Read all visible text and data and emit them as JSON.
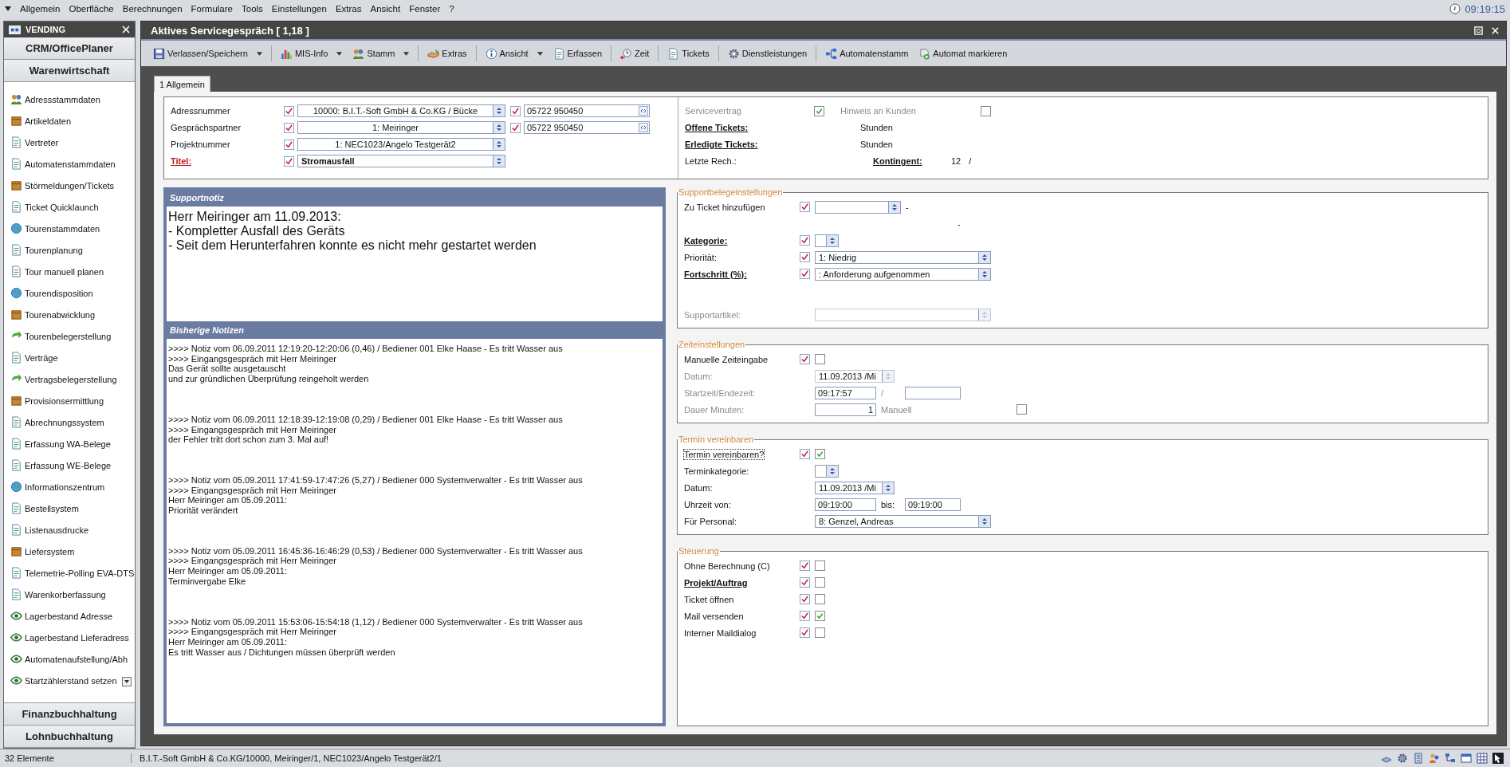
{
  "menu": [
    "Allgemein",
    "Oberfläche",
    "Berechnungen",
    "Formulare",
    "Tools",
    "Einstellungen",
    "Extras",
    "Ansicht",
    "Fenster",
    "?"
  ],
  "clock": "09:19:15",
  "sidebar": {
    "title": "VENDING",
    "top_sections": [
      "CRM/OfficePlaner",
      "Warenwirtschaft"
    ],
    "items": [
      "Adressstammdaten",
      "Artikeldaten",
      "Vertreter",
      "Automatenstammdaten",
      "Störmeldungen/Tickets",
      "Ticket Quicklaunch",
      "Tourenstammdaten",
      "Tourenplanung",
      "Tour manuell planen",
      "Tourendisposition",
      "Tourenabwicklung",
      "Tourenbelegerstellung",
      "Verträge",
      "Vertragsbelegerstellung",
      "Provisionsermittlung",
      "Abrechnungssystem",
      "Erfassung WA-Belege",
      "Erfassung WE-Belege",
      "Informationszentrum",
      "Bestellsystem",
      "Listenausdrucke",
      "Liefersystem",
      "Telemetrie-Polling EVA-DTS",
      "Warenkorberfassung",
      "Lagerbestand Adresse",
      "Lagerbestand Lieferadress",
      "Automatenaufstellung/Abh",
      "Startzählerstand setzen"
    ],
    "bottom_sections": [
      "Finanzbuchhaltung",
      "Lohnbuchhaltung"
    ]
  },
  "window": {
    "title": "Aktives Servicegespräch [ 1,18 ]"
  },
  "toolbar": [
    {
      "label": "Verlassen/Speichern",
      "dropdown": true
    },
    {
      "label": "MIS-Info",
      "dropdown": true
    },
    {
      "label": "Stamm",
      "dropdown": true
    },
    {
      "label": "Extras",
      "dropdown": false
    },
    {
      "label": "Ansicht",
      "dropdown": true
    },
    {
      "label": "Erfassen",
      "dropdown": false
    },
    {
      "label": "Zeit",
      "dropdown": false
    },
    {
      "label": "Tickets",
      "dropdown": false
    },
    {
      "label": "Dienstleistungen",
      "dropdown": false
    },
    {
      "label": "Automatenstamm",
      "dropdown": false
    },
    {
      "label": "Automat markieren",
      "dropdown": false
    }
  ],
  "tabs": [
    {
      "label": "1 Allgemein",
      "selected": true
    }
  ],
  "header_left": [
    {
      "label": "Adressnummer",
      "required": false,
      "value": "10000: B.I.T.-Soft GmbH & Co.KG / Bücke",
      "bold": false,
      "phone": "05722 950450"
    },
    {
      "label": "Gesprächspartner",
      "required": false,
      "value": "1: Meiringer",
      "bold": false,
      "phone": "05722 950450"
    },
    {
      "label": "Projektnummer",
      "required": false,
      "value": "1: NEC1023/Angelo Testgerät2",
      "bold": false
    },
    {
      "label": "Titel:",
      "required": true,
      "value": "Stromausfall",
      "bold": true
    }
  ],
  "header_right": [
    {
      "kind": "checks",
      "label": "Servicevertrag",
      "checked": true,
      "label2": "Hinweis an Kunden",
      "checked2": false
    },
    {
      "kind": "value",
      "label": "Offene Tickets:",
      "value": "Stunden"
    },
    {
      "kind": "value",
      "label": "Erledigte Tickets:",
      "value": "Stunden"
    },
    {
      "kind": "kontingent",
      "label": "Letzte Rech.:",
      "label2": "Kontingent:",
      "value": "12",
      "suffix": "/"
    }
  ],
  "support_note": {
    "title": "Supportnotiz",
    "lines": [
      "Herr Meiringer am 11.09.2013:",
      "- Kompletter Ausfall des Geräts",
      "- Seit dem Herunterfahren konnte es nicht mehr gestartet werden"
    ]
  },
  "previous_notes": {
    "title": "Bisherige Notizen",
    "entries": [
      {
        "lines": [
          ">>>> Notiz vom 06.09.2011 12:19:20-12:20:06 (0,46) / Bediener 001 Elke Haase - Es tritt Wasser aus",
          ">>>> Eingangsgespräch mit Herr Meiringer",
          "Das Gerät sollte ausgetauscht",
          "und zur gründlichen Überprüfung reingeholt werden"
        ]
      },
      {
        "lines": [
          ">>>> Notiz vom 06.09.2011 12:18:39-12:19:08 (0,29) / Bediener 001 Elke Haase - Es tritt Wasser aus",
          ">>>> Eingangsgespräch mit Herr Meiringer",
          "der Fehler tritt dort schon zum 3. Mal auf!"
        ]
      },
      {
        "lines": [
          ">>>> Notiz vom 05.09.2011 17:41:59-17:47:26 (5,27) / Bediener 000 Systemverwalter - Es tritt Wasser aus",
          ">>>> Eingangsgespräch mit Herr Meiringer",
          "Herr Meiringer am 05.09.2011:",
          "Priorität verändert"
        ]
      },
      {
        "lines": [
          ">>>> Notiz vom 05.09.2011 16:45:36-16:46:29 (0,53) / Bediener 000 Systemverwalter - Es tritt Wasser aus",
          ">>>> Eingangsgespräch mit Herr Meiringer",
          "Herr Meiringer am 05.09.2011:",
          "Terminvergabe Elke"
        ]
      },
      {
        "lines": [
          ">>>> Notiz vom 05.09.2011 15:53:06-15:54:18 (1,12) / Bediener 000 Systemverwalter - Es tritt Wasser aus",
          ">>>> Eingangsgespräch mit Herr Meiringer",
          "Herr Meiringer am 05.09.2011:",
          "Es tritt Wasser aus / Dichtungen müssen überprüft werden"
        ]
      }
    ]
  },
  "groups": [
    {
      "title": "Supportbelegeinstellungen",
      "rows": [
        {
          "kind": "combo_short",
          "label": "Zu Ticket hinzufügen",
          "link": false,
          "disabled": false,
          "marked": true,
          "suffix": "-"
        },
        {
          "kind": "dash",
          "value": "-"
        },
        {
          "kind": "combo_mini",
          "label": "Kategorie:",
          "link": true,
          "disabled": false,
          "marked": true
        },
        {
          "kind": "combo",
          "label": "Priorität:",
          "link": false,
          "disabled": false,
          "marked": true,
          "value": "1: Niedrig"
        },
        {
          "kind": "combo",
          "label": "Fortschritt (%):",
          "link": true,
          "disabled": false,
          "marked": true,
          "value": ": Anforderung aufgenommen"
        },
        {
          "kind": "gap"
        },
        {
          "kind": "combo",
          "label": "Supportartikel:",
          "link": false,
          "disabled": true,
          "marked": false
        }
      ]
    },
    {
      "title": "Zeiteinstellungen",
      "rows": [
        {
          "kind": "checkbox",
          "label": "Manuelle Zeiteingabe",
          "link": false,
          "disabled": false,
          "marked": true,
          "checked": false,
          "focused": false
        },
        {
          "kind": "date",
          "label": "Datum:",
          "link": false,
          "disabled": true,
          "marked": false,
          "value": "11.09.2013 /Mi"
        },
        {
          "kind": "range",
          "label": "Startzeit/Endezeit:",
          "link": false,
          "disabled": true,
          "marked": false,
          "from": "09:17:57",
          "separator": "/"
        },
        {
          "kind": "minutes",
          "label": "Dauer Minuten:",
          "link": false,
          "disabled": true,
          "marked": false,
          "value": "1",
          "extra_label": "Manuell",
          "checked": false
        }
      ]
    },
    {
      "title": "Termin vereinbaren",
      "rows": [
        {
          "kind": "checkbox",
          "label": "Termin vereinbaren?",
          "link": false,
          "disabled": false,
          "marked": true,
          "checked": true,
          "focused": true
        },
        {
          "kind": "combo_mini",
          "label": "Terminkategorie:",
          "link": false,
          "disabled": false,
          "marked": false
        },
        {
          "kind": "date",
          "label": "Datum:",
          "link": false,
          "disabled": false,
          "marked": false,
          "value": "11.09.2013 /Mi"
        },
        {
          "kind": "range",
          "label": "Uhrzeit von:",
          "link": false,
          "disabled": false,
          "marked": false,
          "from": "09:19:00",
          "separator": "bis:",
          "to": "09:19:00"
        },
        {
          "kind": "combo",
          "label": "Für Personal:",
          "link": false,
          "disabled": false,
          "marked": false,
          "value": "8: Genzel, Andreas"
        }
      ]
    },
    {
      "title": "Steuerung",
      "rows": [
        {
          "kind": "checkbox",
          "label": "Ohne Berechnung (C)",
          "link": false,
          "disabled": false,
          "marked": true,
          "checked": false,
          "focused": false
        },
        {
          "kind": "checkbox",
          "label": "Projekt/Auftrag",
          "link": true,
          "disabled": false,
          "marked": true,
          "checked": false,
          "focused": false
        },
        {
          "kind": "checkbox",
          "label": "Ticket öffnen",
          "link": false,
          "disabled": false,
          "marked": true,
          "checked": false,
          "focused": false
        },
        {
          "kind": "checkbox",
          "label": "Mail versenden",
          "link": false,
          "disabled": false,
          "marked": true,
          "checked": true,
          "focused": false
        },
        {
          "kind": "checkbox",
          "label": "Interner Maildialog",
          "link": false,
          "disabled": false,
          "marked": true,
          "checked": false,
          "focused": false
        }
      ]
    }
  ],
  "status_bar": {
    "count": "32 Elemente",
    "context": "B.I.T.-Soft GmbH & Co.KG/10000, Meiringer/1, NEC1023/Angelo Testgerät2/1"
  }
}
